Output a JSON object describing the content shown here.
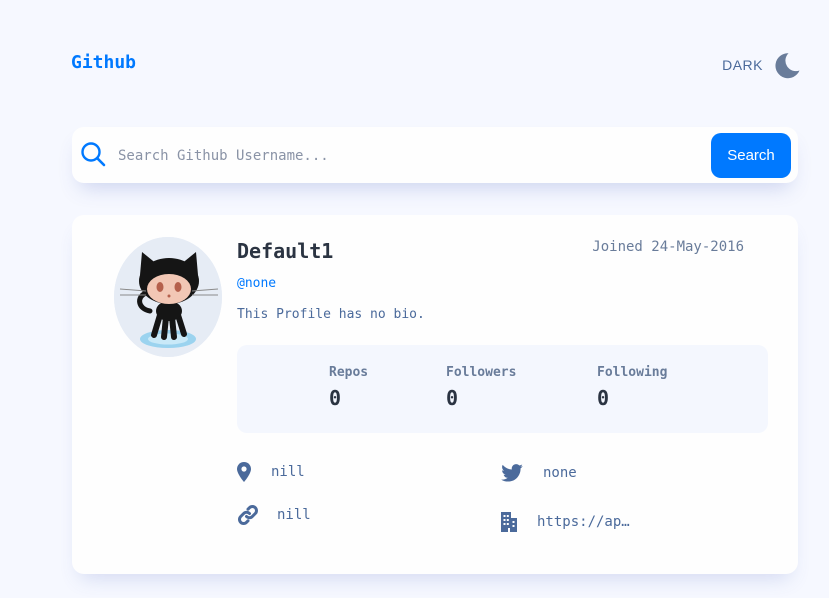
{
  "header": {
    "brand": "Github",
    "theme_label": "DARK",
    "theme_icon": "moon-icon"
  },
  "search": {
    "placeholder": "Search Github Username...",
    "value": "",
    "button_label": "Search",
    "icon": "search-icon"
  },
  "profile": {
    "name": "Default1",
    "login": "@none",
    "joined": "Joined 24-May-2016",
    "bio": "This Profile has no bio.",
    "avatar_icon": "octocat-avatar"
  },
  "stats": [
    {
      "label": "Repos",
      "value": "0"
    },
    {
      "label": "Followers",
      "value": "0"
    },
    {
      "label": "Following",
      "value": "0"
    }
  ],
  "links": {
    "location": {
      "text": "nill",
      "icon": "location-pin-icon"
    },
    "website": {
      "text": "nill",
      "icon": "link-icon"
    },
    "twitter": {
      "text": "none",
      "icon": "twitter-icon"
    },
    "company": {
      "text": "https://ap…",
      "icon": "building-icon"
    }
  },
  "colors": {
    "background": "#f6f8ff",
    "card": "#fefefe",
    "accent": "#0079ff",
    "text_muted": "#4b6a9b",
    "heading": "#2b3442"
  }
}
